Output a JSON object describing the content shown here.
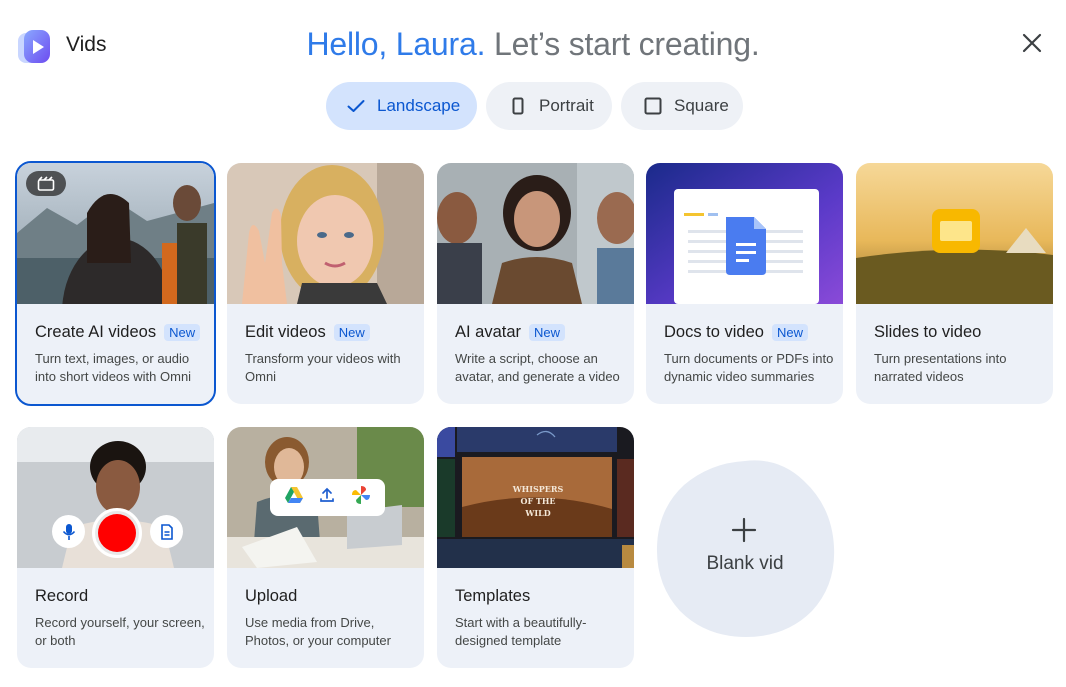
{
  "app": {
    "name": "Vids",
    "logo_icon": "vids-logo-icon",
    "brand_color": "#5b6bf0"
  },
  "greeting": {
    "hello": "Hello, Laura.",
    "rest": "Let’s start creating.",
    "hello_color": "#2f7be9"
  },
  "close_icon": "close-icon",
  "orientation": {
    "options": [
      {
        "label": "Landscape",
        "icon": "checkmark-icon",
        "selected": true
      },
      {
        "label": "Portrait",
        "icon": "portrait-frame-icon",
        "selected": false
      },
      {
        "label": "Square",
        "icon": "square-frame-icon",
        "selected": false
      }
    ]
  },
  "cards": [
    {
      "title": "Create AI videos",
      "badge": "New",
      "desc": "Turn text, images, or audio into short videos with Omni",
      "selected": true
    },
    {
      "title": "Edit videos",
      "badge": "New",
      "desc": "Transform your videos with Omni"
    },
    {
      "title": "AI avatar",
      "badge": "New",
      "desc": "Write a script, choose an avatar, and generate a video"
    },
    {
      "title": "Docs to video",
      "badge": "New",
      "desc": "Turn documents or PDFs into dynamic video summaries"
    },
    {
      "title": "Slides to video",
      "badge": "",
      "desc": "Turn presentations into narrated videos"
    },
    {
      "title": "Record",
      "badge": "",
      "desc": "Record yourself, your screen, or both"
    },
    {
      "title": "Upload",
      "badge": "",
      "desc": "Use media from Drive, Photos, or your computer"
    },
    {
      "title": "Templates",
      "badge": "",
      "desc": "Start with a beautifully-designed template",
      "thumb_text": "WHISPERS OF THE WILD"
    }
  ],
  "blank": {
    "label": "Blank vid",
    "icon": "plus-icon"
  },
  "colors": {
    "accent": "#0b57d0",
    "chip_active": "#d3e3fd",
    "card_bg": "#edf1f8",
    "record_red": "#ff0000"
  }
}
